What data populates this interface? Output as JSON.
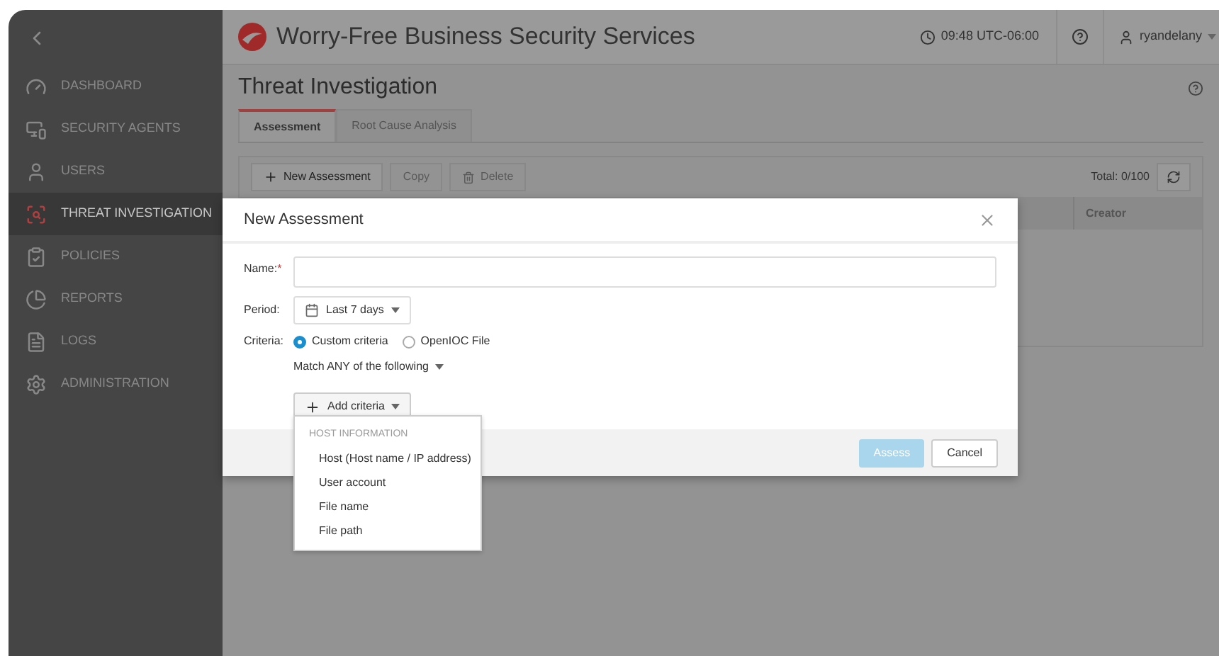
{
  "app": {
    "title": "Worry-Free Business Security Services",
    "time": "09:48 UTC-06:00",
    "user": "ryandelany"
  },
  "sidebar": {
    "items": [
      {
        "kind": "dashboard",
        "label": "DASHBOARD",
        "selected": false
      },
      {
        "kind": "agents",
        "label": "SECURITY AGENTS",
        "selected": false
      },
      {
        "kind": "users",
        "label": "USERS",
        "selected": false
      },
      {
        "kind": "threat",
        "label": "THREAT INVESTIGATION",
        "selected": true
      },
      {
        "kind": "policies",
        "label": "POLICIES",
        "selected": false
      },
      {
        "kind": "reports",
        "label": "REPORTS",
        "selected": false
      },
      {
        "kind": "logs",
        "label": "LOGS",
        "selected": false
      },
      {
        "kind": "admin",
        "label": "ADMINISTRATION",
        "selected": false
      }
    ]
  },
  "page": {
    "title": "Threat Investigation",
    "tabs": [
      {
        "label": "Assessment",
        "selected": true
      },
      {
        "label": "Root Cause Analysis",
        "selected": false
      }
    ],
    "toolbar": [
      {
        "kind": "add",
        "label": "New Assessment",
        "disabled": false
      },
      {
        "kind": "plain",
        "label": "Copy",
        "disabled": true
      },
      {
        "kind": "delete",
        "label": "Delete",
        "disabled": true
      }
    ],
    "total": "Total: 0/100",
    "table": {
      "columns": [
        "Creator"
      ]
    }
  },
  "dialog": {
    "title": "New Assessment",
    "name": {
      "label": "Name:",
      "required": true,
      "required_mark": "*"
    },
    "period": {
      "label": "Period:",
      "value": "Last 7 days"
    },
    "criteria": {
      "label": "Criteria:",
      "options": [
        {
          "label": "Custom criteria",
          "selected": true
        },
        {
          "label": "OpenIOC File",
          "selected": false
        }
      ]
    },
    "match": "Match ANY of the following",
    "add_button": "Add criteria",
    "menu": {
      "group": "HOST INFORMATION",
      "items": [
        "Host (Host name / IP address)",
        "User account",
        "File name",
        "File path"
      ]
    },
    "buttons": [
      {
        "kind": "primary",
        "label": "Assess",
        "disabled": true
      },
      {
        "kind": "secondary",
        "label": "Cancel",
        "disabled": false
      }
    ]
  }
}
